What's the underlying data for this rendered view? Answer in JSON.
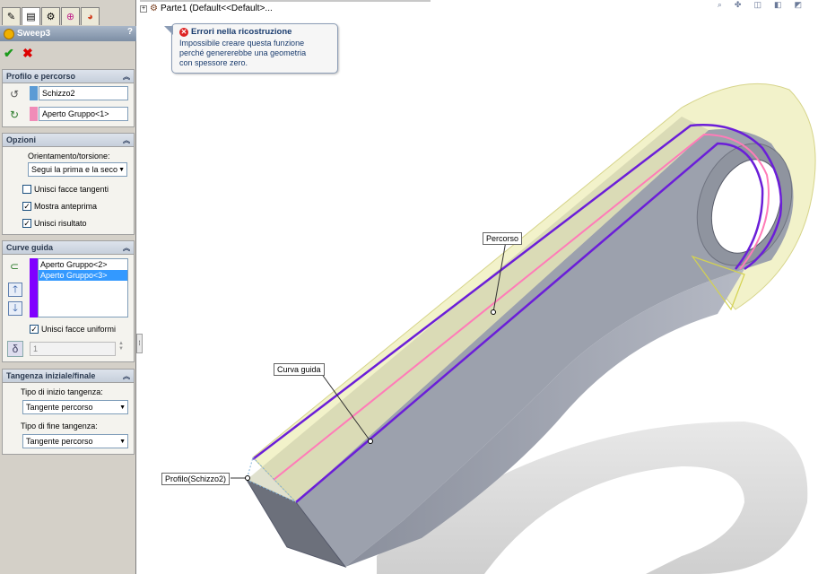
{
  "feature": {
    "title": "Sweep3",
    "help": "?"
  },
  "actions": {
    "ok": "✔",
    "cancel": "✖"
  },
  "tree": {
    "part_label": "Parte1  (Default<<Default>..."
  },
  "tooltip": {
    "title": "Errori nella ricostruzione",
    "message_lines": [
      "Impossibile creare questa funzione",
      "perché genererebbe una geometria",
      "con spessore zero."
    ]
  },
  "profile_path": {
    "header": "Profilo e percorso",
    "profile_value": "Schizzo2",
    "path_value": "Aperto Gruppo<1>",
    "colors": {
      "profile": "#5b9bd5",
      "path": "#f08cb8"
    }
  },
  "options": {
    "header": "Opzioni",
    "orientation_label": "Orientamento/torsione:",
    "orientation_value": "Segui la prima e la seco",
    "merge_tangent_label": "Unisci facce tangenti",
    "show_preview_label": "Mostra anteprima",
    "merge_result_label": "Unisci risultato",
    "checks": {
      "merge_tangent": false,
      "show_preview": true,
      "merge_result": true
    }
  },
  "guide_curves": {
    "header": "Curve guida",
    "items": [
      "Aperto Gruppo<2>",
      "Aperto Gruppo<3>"
    ],
    "merge_smooth_label": "Unisci facce uniformi",
    "merge_smooth_checked": true,
    "section_count": "1",
    "color": "#8000ff"
  },
  "tangency": {
    "header": "Tangenza iniziale/finale",
    "start_label": "Tipo di inizio tangenza:",
    "start_value": "Tangente percorso",
    "end_label": "Tipo di fine tangenza:",
    "end_value": "Tangente percorso"
  },
  "callouts": {
    "path": "Percorso",
    "guide": "Curva guida",
    "profile": "Profilo(Schizzo2)"
  }
}
